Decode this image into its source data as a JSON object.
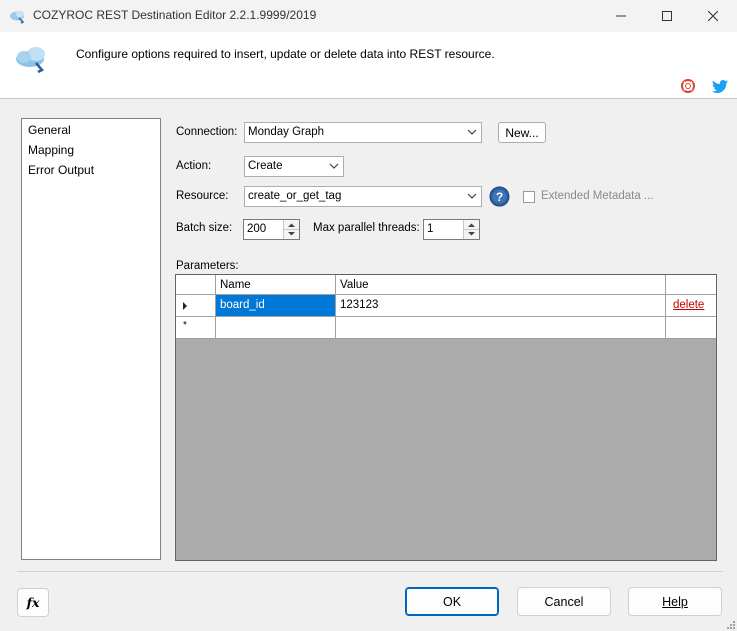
{
  "window": {
    "title": "COZYROC REST Destination Editor 2.2.1.9999/2019",
    "minimize_icon": "minimize-icon",
    "maximize_icon": "maximize-icon",
    "close_icon": "close-icon"
  },
  "header": {
    "description": "Configure options required to insert, update or delete data into REST resource.",
    "icons": [
      "cloud-icon",
      "lifebuoy-icon",
      "twitter-icon"
    ]
  },
  "sidebar": {
    "items": [
      {
        "label": "General"
      },
      {
        "label": "Mapping"
      },
      {
        "label": "Error Output"
      }
    ]
  },
  "form": {
    "connection_label": "Connection:",
    "connection_value": "Monday Graph",
    "new_button": "New...",
    "action_label": "Action:",
    "action_value": "Create",
    "resource_label": "Resource:",
    "resource_value": "create_or_get_tag",
    "extended_metadata_label": "Extended Metadata ...",
    "extended_metadata_checked": false,
    "batch_size_label": "Batch size:",
    "batch_size_value": "200",
    "max_threads_label": "Max parallel threads:",
    "max_threads_value": "1",
    "parameters_label": "Parameters:"
  },
  "parameters": {
    "columns": [
      "Name",
      "Value"
    ],
    "rows": [
      {
        "name": "board_id",
        "value": "123123",
        "action": "delete"
      }
    ],
    "new_row_marker": "*"
  },
  "footer": {
    "fx_button": "fx",
    "ok_button": "OK",
    "cancel_button": "Cancel",
    "help_button": "Help"
  },
  "colors": {
    "selection": "#0078d7",
    "delete_link": "#c00000",
    "help_icon": "#2f5f9e"
  }
}
